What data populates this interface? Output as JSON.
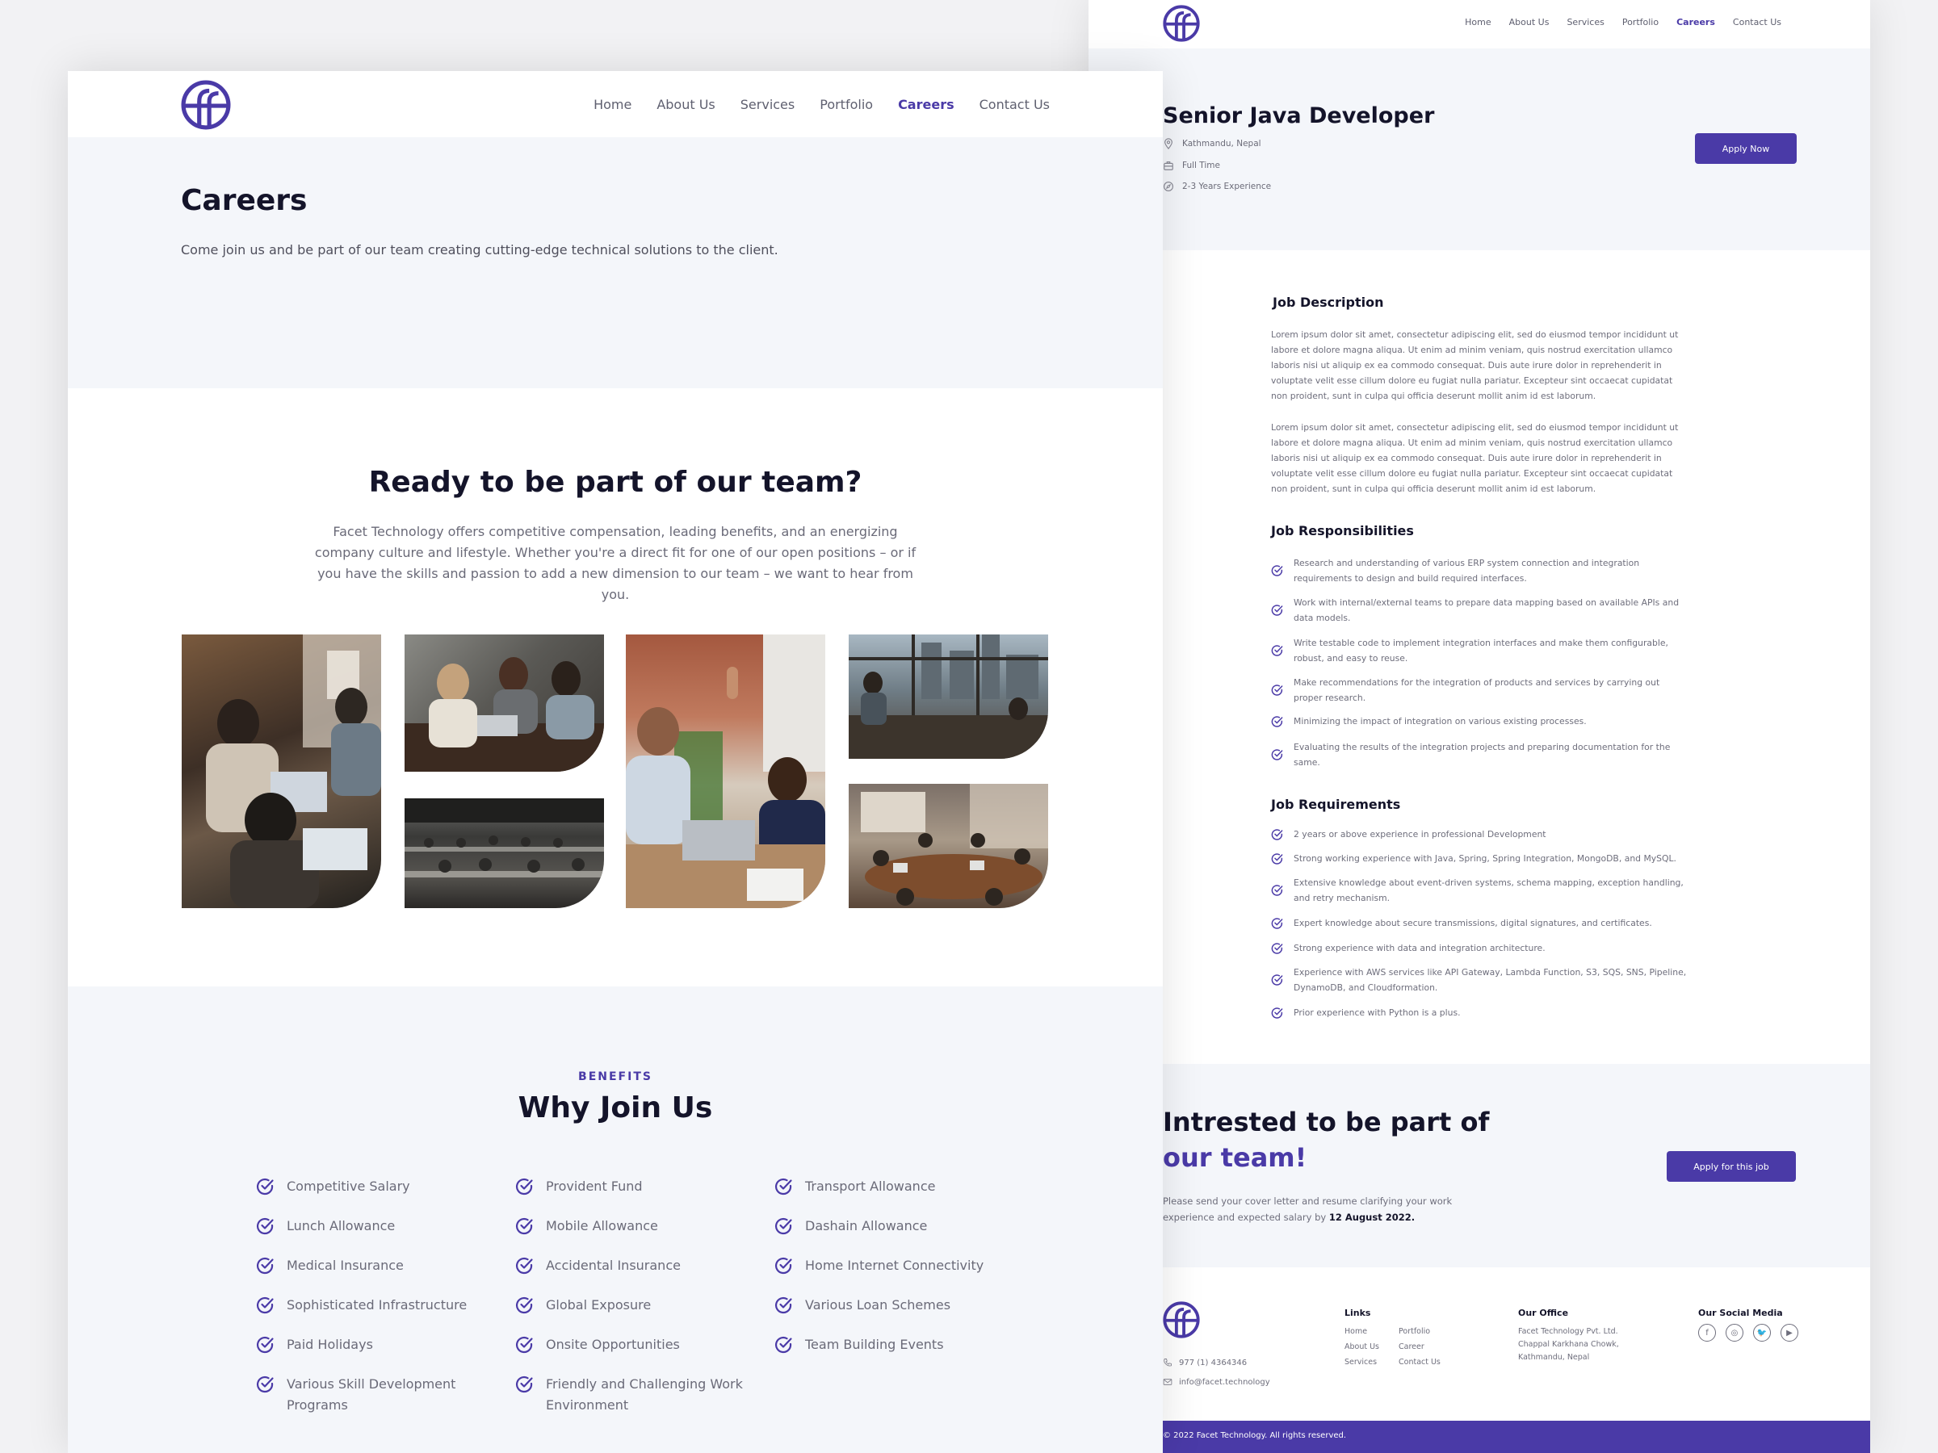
{
  "colors": {
    "accent": "#4a3aa7",
    "heading": "#14142a",
    "page_bg": "#f4f6fa"
  },
  "detail_page": {
    "nav": {
      "items": [
        "Home",
        "About Us",
        "Services",
        "Portfolio",
        "Careers",
        "Contact Us"
      ],
      "active": "Careers"
    },
    "job": {
      "title": "Senior Java Developer",
      "location": "Kathmandu, Nepal",
      "type": "Full Time",
      "experience": "2-3 Years Experience",
      "apply_label": "Apply Now"
    },
    "description": {
      "heading": "Job Description",
      "paragraphs": [
        "Lorem ipsum dolor sit amet, consectetur adipiscing elit, sed do eiusmod tempor incididunt ut labore et dolore magna aliqua. Ut enim ad minim veniam, quis nostrud exercitation ullamco laboris nisi ut aliquip ex ea commodo consequat. Duis aute irure dolor in reprehenderit in voluptate velit esse cillum dolore eu fugiat nulla pariatur. Excepteur sint occaecat cupidatat non proident, sunt in culpa qui officia deserunt mollit anim id est laborum.",
        "Lorem ipsum dolor sit amet, consectetur adipiscing elit, sed do eiusmod tempor incididunt ut labore et dolore magna aliqua. Ut enim ad minim veniam, quis nostrud exercitation ullamco laboris nisi ut aliquip ex ea commodo consequat. Duis aute irure dolor in reprehenderit in voluptate velit esse cillum dolore eu fugiat nulla pariatur. Excepteur sint occaecat cupidatat non proident, sunt in culpa qui officia deserunt mollit anim id est laborum."
      ]
    },
    "responsibilities": {
      "heading": "Job Responsibilities",
      "items": [
        "Research and understanding of various ERP system connection and integration requirements to design and build required interfaces.",
        "Work with internal/external teams to prepare data mapping based on available APIs and data models.",
        "Write testable code to implement integration interfaces and make them configurable, robust, and easy to reuse.",
        "Make recommendations for the integration of products and services by carrying out proper research.",
        "Minimizing the impact of integration on various existing processes.",
        "Evaluating the results of the integration projects and preparing documentation for the same."
      ]
    },
    "requirements": {
      "heading": "Job Requirements",
      "items": [
        "2 years or above experience in professional Development",
        "Strong working experience with Java, Spring, Spring Integration, MongoDB, and MySQL.",
        "Extensive knowledge about event-driven systems, schema mapping, exception handling, and retry mechanism.",
        "Expert knowledge about secure transmissions, digital signatures, and certificates.",
        "Strong experience with data and integration architecture.",
        "Experience with AWS services like API Gateway, Lambda Function, S3, SQS, SNS, Pipeline, DynamoDB, and Cloudformation.",
        "Prior experience with Python is a plus."
      ]
    },
    "cta": {
      "heading_prefix": "Intrested to be part of ",
      "heading_highlight": "our team!",
      "text": "Please send your cover letter and resume clarifying your work experience and expected salary by ",
      "deadline": "12 August 2022.",
      "button": "Apply for this job"
    },
    "footer": {
      "phone": "977 (1) 4364346",
      "email": "info@facet.technology",
      "links_heading": "Links",
      "links": [
        "Home",
        "About Us",
        "Services",
        "Portfolio",
        "Career",
        "Contact Us"
      ],
      "office_heading": "Our Office",
      "office_lines": [
        "Facet Technology Pvt. Ltd.",
        "Chappal Karkhana Chowk,",
        "Kathmandu, Nepal"
      ],
      "social_heading": "Our Social Media",
      "social": [
        "facebook-icon",
        "instagram-icon",
        "twitter-icon",
        "youtube-icon"
      ],
      "copyright": "© 2022 Facet Technology. All rights reserved."
    }
  },
  "careers_page": {
    "nav": {
      "items": [
        "Home",
        "About Us",
        "Services",
        "Portfolio",
        "Careers",
        "Contact Us"
      ],
      "active": "Careers"
    },
    "hero": {
      "title": "Careers",
      "subtitle": "Come join us and be part of our team creating cutting-edge technical solutions to the client."
    },
    "team": {
      "heading": "Ready to be part of our team?",
      "text": "Facet Technology offers competitive compensation, leading benefits, and an energizing company culture and lifestyle. Whether you're a direct fit for one of our open positions – or if you have the skills and passion to add a new dimension to our team – we want to hear from you.",
      "photos": [
        "team-laptops-photo",
        "team-meeting-photo",
        "open-office-photo",
        "high-five-photo",
        "office-window-photo",
        "conference-room-photo"
      ]
    },
    "benefits": {
      "kicker": "BENEFITS",
      "heading": "Why Join Us",
      "columns": [
        [
          "Competitive Salary",
          "Lunch Allowance",
          "Medical Insurance",
          "Sophisticated Infrastructure",
          "Paid Holidays",
          "Various Skill Development Programs"
        ],
        [
          "Provident Fund",
          "Mobile Allowance",
          "Accidental Insurance",
          "Global Exposure",
          "Onsite Opportunities",
          "Friendly and Challenging Work Environment"
        ],
        [
          "Transport Allowance",
          "Dashain Allowance",
          "Home Internet Connectivity",
          "Various Loan Schemes",
          "Team Building Events"
        ]
      ]
    }
  }
}
